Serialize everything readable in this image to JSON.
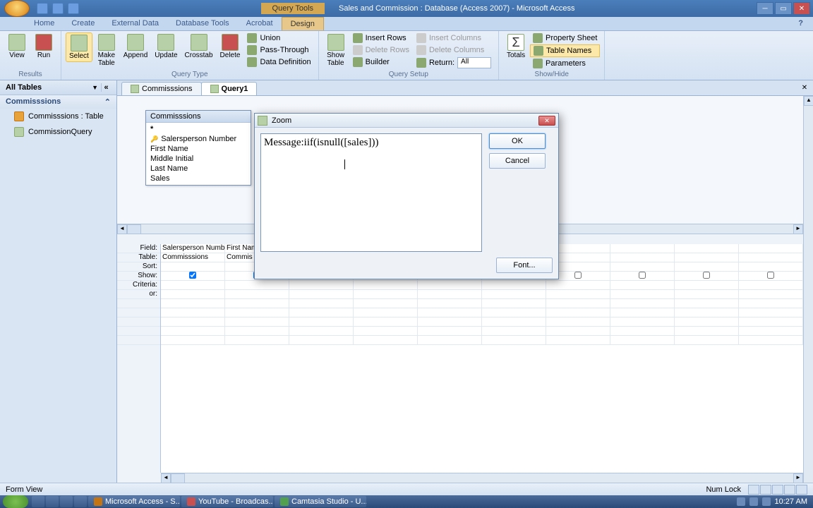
{
  "title": {
    "context_tab": "Query Tools",
    "app_title": "Sales and Commission : Database (Access 2007) - Microsoft Access"
  },
  "ribbon_tabs": [
    "Home",
    "Create",
    "External Data",
    "Database Tools",
    "Acrobat",
    "Design"
  ],
  "ribbon": {
    "results": {
      "label": "Results",
      "view": "View",
      "run": "Run"
    },
    "query_type": {
      "label": "Query Type",
      "select": "Select",
      "make_table": "Make\nTable",
      "append": "Append",
      "update": "Update",
      "crosstab": "Crosstab",
      "delete": "Delete",
      "union": "Union",
      "passthrough": "Pass-Through",
      "datadef": "Data Definition"
    },
    "query_setup": {
      "label": "Query Setup",
      "show_table": "Show\nTable",
      "insert_rows": "Insert Rows",
      "delete_rows": "Delete Rows",
      "builder": "Builder",
      "insert_cols": "Insert Columns",
      "delete_cols": "Delete Columns",
      "return": "Return:",
      "return_val": "All"
    },
    "showhide": {
      "label": "Show/Hide",
      "totals": "Totals",
      "prop_sheet": "Property Sheet",
      "table_names": "Table Names",
      "parameters": "Parameters"
    }
  },
  "nav": {
    "header": "All Tables",
    "group": "Commisssions",
    "items": [
      {
        "label": "Commisssions : Table",
        "type": "table"
      },
      {
        "label": "CommissionQuery",
        "type": "query"
      }
    ]
  },
  "doc_tabs": [
    "Commisssions",
    "Query1"
  ],
  "table_box": {
    "title": "Commisssions",
    "fields": [
      "*",
      "Salersperson Number",
      "First Name",
      "Middle Initial",
      "Last Name",
      "Sales"
    ]
  },
  "grid": {
    "labels": [
      "Field:",
      "Table:",
      "Sort:",
      "Show:",
      "Criteria:",
      "or:"
    ],
    "cols": [
      {
        "field": "Salersperson Number",
        "table": "Commisssions",
        "show": true
      },
      {
        "field": "First Name",
        "table": "Commis",
        "show": true
      },
      {
        "field": "",
        "table": "",
        "show": true
      },
      {
        "field": "",
        "table": "",
        "show": true
      },
      {
        "field": "",
        "table": "",
        "show": true
      },
      {
        "field": "",
        "table": "",
        "show": false
      },
      {
        "field": "",
        "table": "",
        "show": false
      },
      {
        "field": "",
        "table": "",
        "show": false
      },
      {
        "field": "",
        "table": "",
        "show": false
      },
      {
        "field": "",
        "table": "",
        "show": false
      }
    ]
  },
  "zoom": {
    "title": "Zoom",
    "text": "Message:iif(isnull([sales]))",
    "ok": "OK",
    "cancel": "Cancel",
    "font": "Font..."
  },
  "status": {
    "left": "Form View",
    "numlock": "Num Lock"
  },
  "taskbar": {
    "items": [
      "Microsoft Access - S...",
      "YouTube - Broadcas...",
      "Camtasia Studio - U..."
    ],
    "time": "10:27 AM"
  }
}
